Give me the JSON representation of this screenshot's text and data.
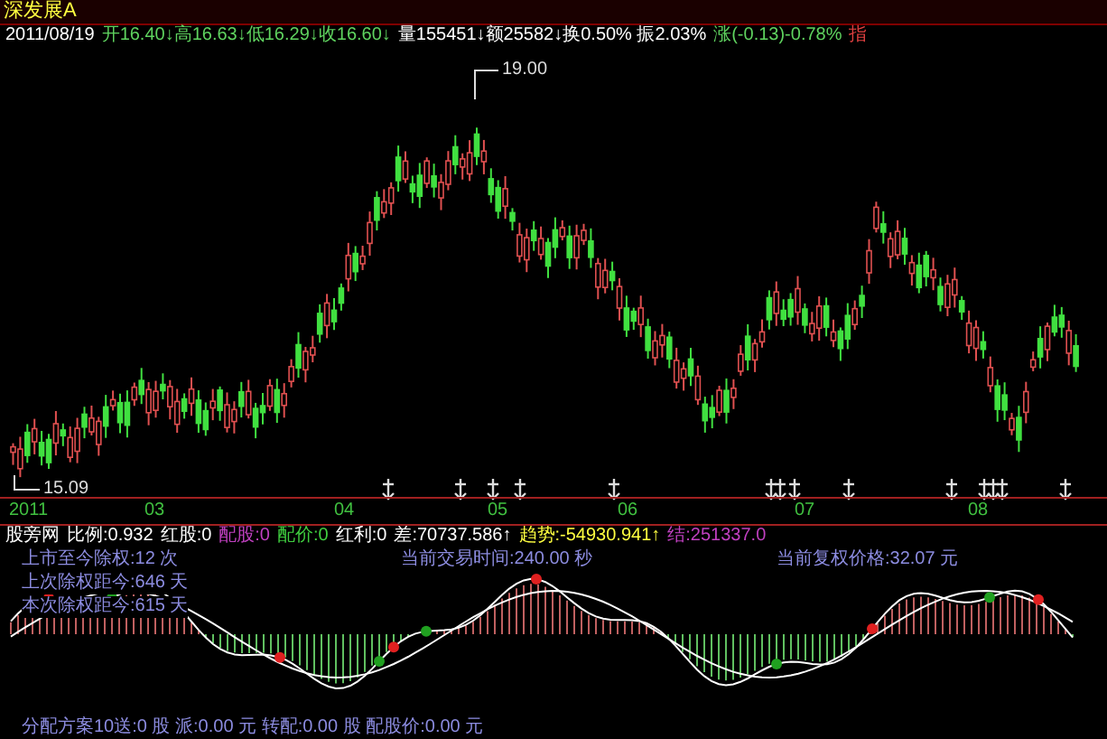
{
  "title": "深发展A",
  "quote": [
    {
      "text": "2011/08/19",
      "color": "#ffffff"
    },
    {
      "text": "开16.40↓高16.63↓低16.29↓收16.60↓",
      "color": "#5fd35f"
    },
    {
      "text": "量155451↓额25582↓换0.50% 振2.03%",
      "color": "#ffffff"
    },
    {
      "text": "涨(-0.13)-0.78%",
      "color": "#5fd35f"
    },
    {
      "text": "指",
      "color": "#e04040"
    }
  ],
  "price_labels": {
    "high": "19.00",
    "low": "15.09"
  },
  "axis_labels": [
    "2011",
    "03",
    "04",
    "05",
    "06",
    "07",
    "08"
  ],
  "indicator": [
    {
      "text": "股旁网",
      "color": "#ffffff"
    },
    {
      "text": "比例:0.932",
      "color": "#ffffff"
    },
    {
      "text": "红股:0",
      "color": "#ffffff"
    },
    {
      "text": "配股:0",
      "color": "#c040c0"
    },
    {
      "text": "配价:0",
      "color": "#40d040"
    },
    {
      "text": "红利:0",
      "color": "#ffffff"
    },
    {
      "text": "差:70737.586↑",
      "color": "#ffffff"
    },
    {
      "text": "趋势:-54930.941↑",
      "color": "#ffff40"
    },
    {
      "text": "结:251337.0",
      "color": "#c040c0"
    }
  ],
  "info": {
    "listing_exrights": "上市至今除权:12 次",
    "last_exright": "上次除权距今:646 天",
    "this_exright": "本次除权距今:615 天",
    "trade_time": "当前交易时间:240.00 秒",
    "adjusted_price": "当前复权价格:32.07 元"
  },
  "distribution": "分配方案10送:0 股 派:0.00 元 转配:0.00 股 配股价:0.00 元"
}
